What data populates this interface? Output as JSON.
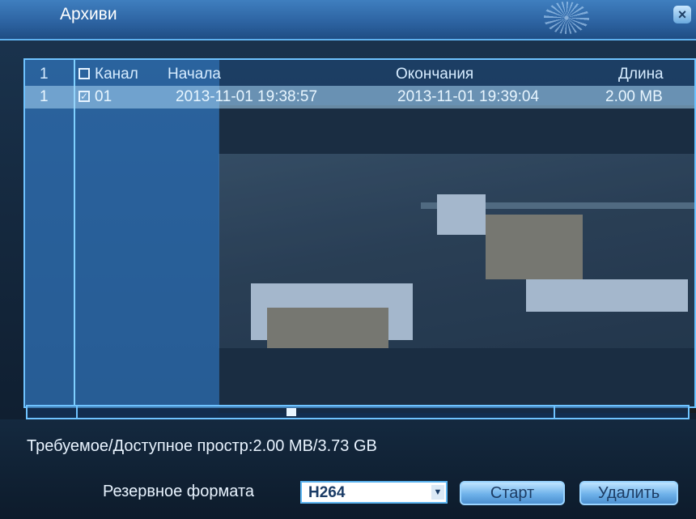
{
  "window": {
    "title": "Архиви"
  },
  "list": {
    "header": {
      "index": "1",
      "channel": "Канал",
      "start": "Начала",
      "end": "Окончания",
      "length": "Длина"
    },
    "rows": [
      {
        "index": "1",
        "checked": true,
        "channel": "01",
        "start": "2013-11-01 19:38:57",
        "end": "2013-11-01 19:39:04",
        "length": "2.00 MB"
      }
    ]
  },
  "status": {
    "space": "Требуемое/Доступное простр:2.00 MB/3.73 GB"
  },
  "backup": {
    "format_label": "Резервное формата",
    "format_value": "H264",
    "start_button": "Старт",
    "delete_button": "Удалить"
  },
  "colors": {
    "accent": "#6fc3ff",
    "title_bar": "#2c62a0",
    "row_highlight": "#aad7f5"
  }
}
